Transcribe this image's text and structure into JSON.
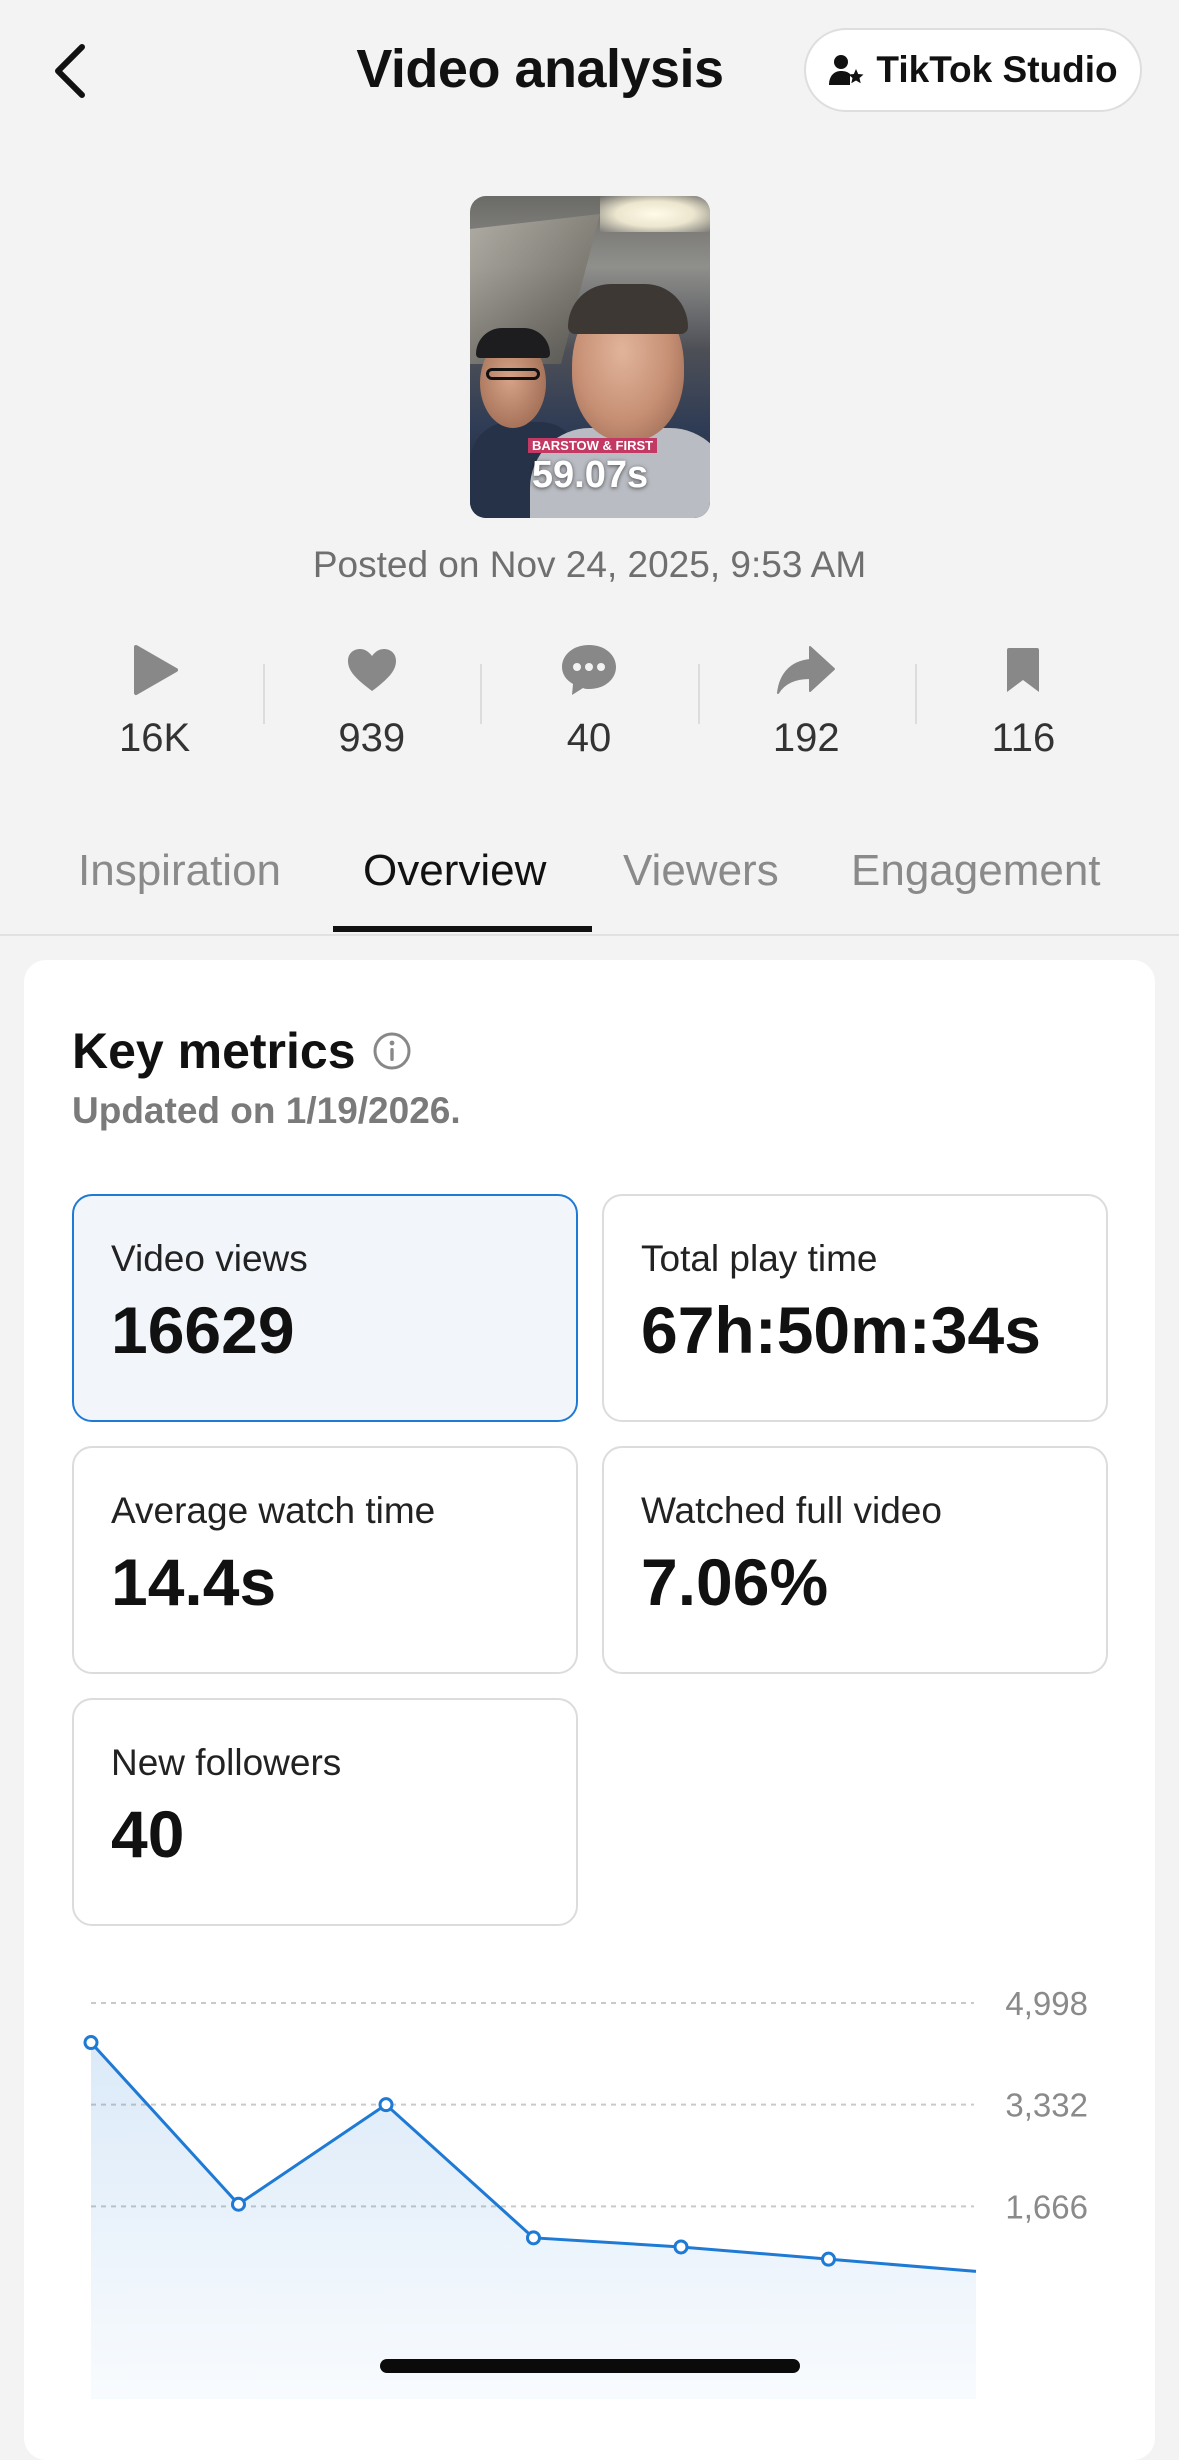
{
  "header": {
    "title": "Video analysis",
    "studio_label": "TikTok Studio"
  },
  "video": {
    "thumbnail_caption": "BARSTOW & FIRST",
    "duration": "59.07s",
    "posted": "Posted on Nov 24, 2025, 9:53 AM"
  },
  "stats": [
    {
      "icon": "play-icon",
      "value": "16K"
    },
    {
      "icon": "heart-icon",
      "value": "939"
    },
    {
      "icon": "comment-icon",
      "value": "40"
    },
    {
      "icon": "share-icon",
      "value": "192"
    },
    {
      "icon": "bookmark-icon",
      "value": "116"
    }
  ],
  "tabs": [
    {
      "label": "Inspiration",
      "active": false
    },
    {
      "label": "Overview",
      "active": true
    },
    {
      "label": "Viewers",
      "active": false
    },
    {
      "label": "Engagement",
      "active": false
    }
  ],
  "key_metrics": {
    "title": "Key metrics",
    "updated": "Updated on 1/19/2026.",
    "items": [
      {
        "label": "Video views",
        "value": "16629",
        "selected": true
      },
      {
        "label": "Total play time",
        "value": "67h:50m:34s",
        "selected": false
      },
      {
        "label": "Average watch time",
        "value": "14.4s",
        "selected": false
      },
      {
        "label": "Watched full video",
        "value": "7.06%",
        "selected": false
      },
      {
        "label": "New followers",
        "value": "40",
        "selected": false
      }
    ]
  },
  "colors": {
    "accent": "#1e7ad4",
    "selected_bg": "#f2f6fb"
  },
  "chart_data": {
    "type": "area",
    "y_ticks": [
      {
        "value": 4998,
        "label": "4,998"
      },
      {
        "value": 3332,
        "label": "3,332"
      },
      {
        "value": 1666,
        "label": "1,666"
      }
    ],
    "ylim": [
      0,
      4998
    ],
    "grid": true,
    "values": [
      4350,
      1700,
      3332,
      1150,
      1000,
      800,
      600
    ],
    "visible_points": 6
  }
}
